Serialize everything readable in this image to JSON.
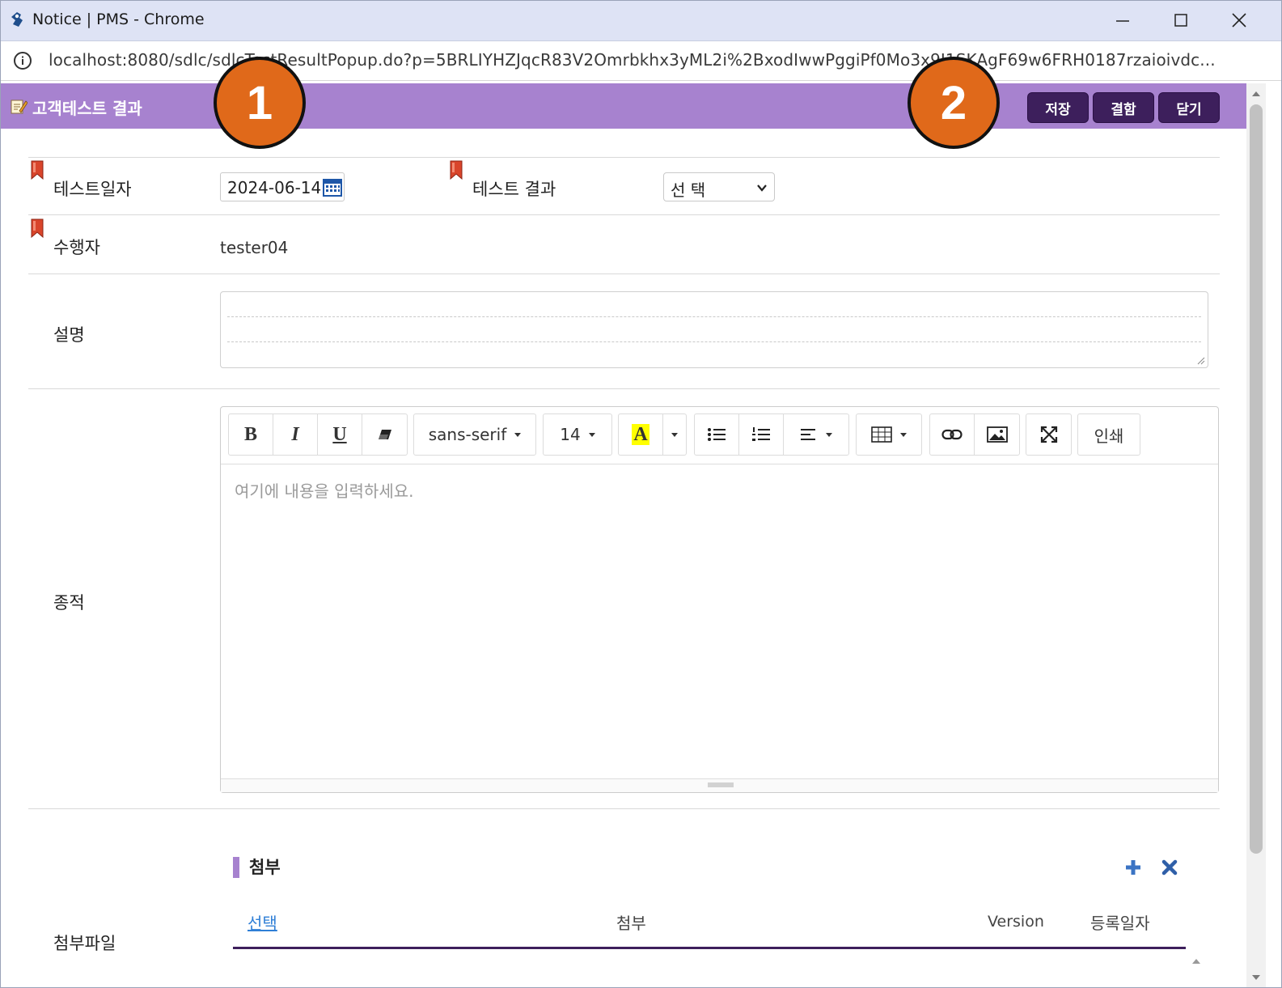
{
  "window": {
    "title": "Notice | PMS - Chrome"
  },
  "address": {
    "url": "localhost:8080/sdlc/sdlcTestResultPopup.do?p=5BRLIYHZJqcR83V2Omrbkhx3yML2i%2BxodIwwPggiPf0Mo3x9J1SKAgF69w6FRH0187rzaioivdc..."
  },
  "header": {
    "title": "고객테스트 결과",
    "save_label": "저장",
    "combine_label": "결함",
    "close_label": "닫기"
  },
  "annotations": [
    "1",
    "2"
  ],
  "form": {
    "test_date_label": "테스트일자",
    "test_date_value": "2024-06-14",
    "test_result_label": "테스트 결과",
    "test_result_value": "선 택",
    "performer_label": "수행자",
    "performer_value": "tester04",
    "description_label": "설명",
    "tracking_label": "종적",
    "attachment_label": "첨부파일"
  },
  "editor": {
    "font_family": "sans-serif",
    "font_size": "14",
    "color_glyph": "A",
    "print_label": "인쇄",
    "placeholder": "여기에 내용을 입력하세요."
  },
  "attachments": {
    "section_title": "첨부",
    "columns": {
      "select": "선택",
      "file": "첨부",
      "version": "Version",
      "date": "등록일자"
    }
  },
  "colors": {
    "header_bg": "#a782cf",
    "button_bg": "#3d1f5c",
    "badge": "#e0691a",
    "required_marker": "#d9452b"
  }
}
